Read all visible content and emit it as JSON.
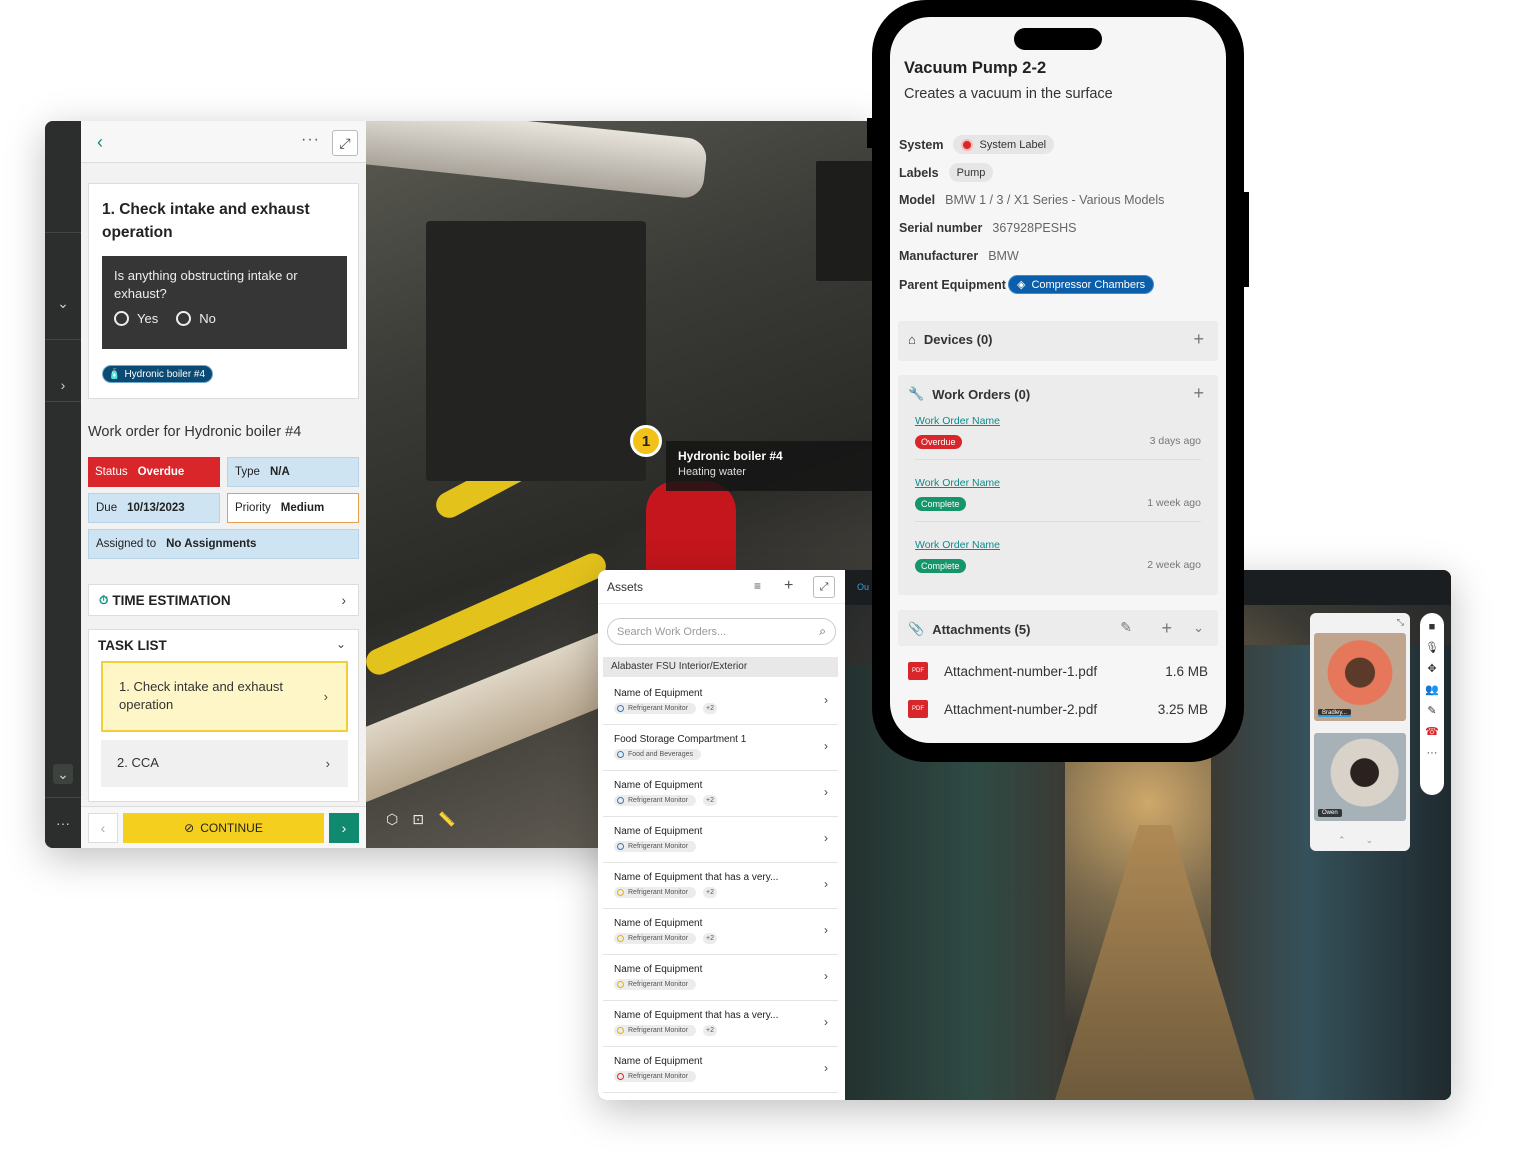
{
  "desktop": {
    "step_title": "1. Check intake and exhaust operation",
    "question": "Is anything obstructing intake or exhaust?",
    "options": [
      "Yes",
      "No"
    ],
    "asset_chip": "Hydronic boiler #4",
    "work_order_title": "Work order for Hydronic boiler #4",
    "fields": {
      "status_label": "Status",
      "status_value": "Overdue",
      "type_label": "Type",
      "type_value": "N/A",
      "due_label": "Due",
      "due_value": "10/13/2023",
      "priority_label": "Priority",
      "priority_value": "Medium",
      "assigned_label": "Assigned to",
      "assigned_value": "No Assignments"
    },
    "time_estimation": "TIME ESTIMATION",
    "task_list": {
      "header": "TASK LIST",
      "tasks": [
        "1.  Check intake and exhaust operation",
        "2.  CCA"
      ]
    },
    "continue_label": "CONTINUE",
    "marker_number": "1",
    "tooltip_title": "Hydronic boiler #4",
    "tooltip_subtitle": "Heating water"
  },
  "tablet": {
    "assets_title": "Assets",
    "search_placeholder": "Search Work Orders...",
    "group": "Alabaster FSU Interior/Exterior",
    "tab_fragment": "Ou",
    "assets": [
      {
        "name": "Name of Equipment",
        "tag": "Refrigerant Monitor",
        "more": "+2",
        "dot": "#3a78b8"
      },
      {
        "name": "Food Storage Compartment 1",
        "tag": "Food and Beverages",
        "more": "",
        "dot": "#3a78b8"
      },
      {
        "name": "Name of Equipment",
        "tag": "Refrigerant Monitor",
        "more": "+2",
        "dot": "#3a78b8"
      },
      {
        "name": "Name of Equipment",
        "tag": "Refrigerant Monitor",
        "more": "",
        "dot": "#3a78b8"
      },
      {
        "name": "Name of Equipment that has a very...",
        "tag": "Refrigerant Monitor",
        "more": "+2",
        "dot": "#e0b21e"
      },
      {
        "name": "Name of Equipment",
        "tag": "Refrigerant Monitor",
        "more": "+2",
        "dot": "#e0b21e"
      },
      {
        "name": "Name of Equipment",
        "tag": "Refrigerant Monitor",
        "more": "",
        "dot": "#e0b21e"
      },
      {
        "name": "Name of Equipment that has a very...",
        "tag": "Refrigerant Monitor",
        "more": "+2",
        "dot": "#e0b21e"
      },
      {
        "name": "Name of Equipment",
        "tag": "Refrigerant Monitor",
        "more": "",
        "dot": "#d9262b"
      }
    ],
    "participants": [
      "Bradley...",
      "Owen"
    ]
  },
  "phone": {
    "title": "Vacuum Pump 2-2",
    "subtitle": "Creates a vacuum in the surface",
    "system_label": "System",
    "system_value": "System Label",
    "labels_label": "Labels",
    "labels_value": "Pump",
    "model_label": "Model",
    "model_value": "BMW 1 / 3 / X1 Series - Various Models",
    "serial_label": "Serial number",
    "serial_value": "367928PESHS",
    "manufacturer_label": "Manufacturer",
    "manufacturer_value": "BMW",
    "parent_label": "Parent Equipment",
    "parent_value": "Compressor Chambers",
    "devices": "Devices (0)",
    "work_orders": "Work Orders (0)",
    "orders": [
      {
        "name": "Work Order Name",
        "status": "Overdue",
        "color": "#d9262b",
        "ago": "3 days ago"
      },
      {
        "name": "Work Order Name",
        "status": "Complete",
        "color": "#14956a",
        "ago": "1 week ago"
      },
      {
        "name": "Work Order Name",
        "status": "Complete",
        "color": "#14956a",
        "ago": "2 week ago"
      }
    ],
    "attachments": "Attachments (5)",
    "files": [
      {
        "name": "Attachment-number-1.pdf",
        "size": "1.6 MB"
      },
      {
        "name": "Attachment-number-2.pdf",
        "size": "3.25 MB"
      }
    ],
    "pdf_icon_text": "PDF"
  }
}
